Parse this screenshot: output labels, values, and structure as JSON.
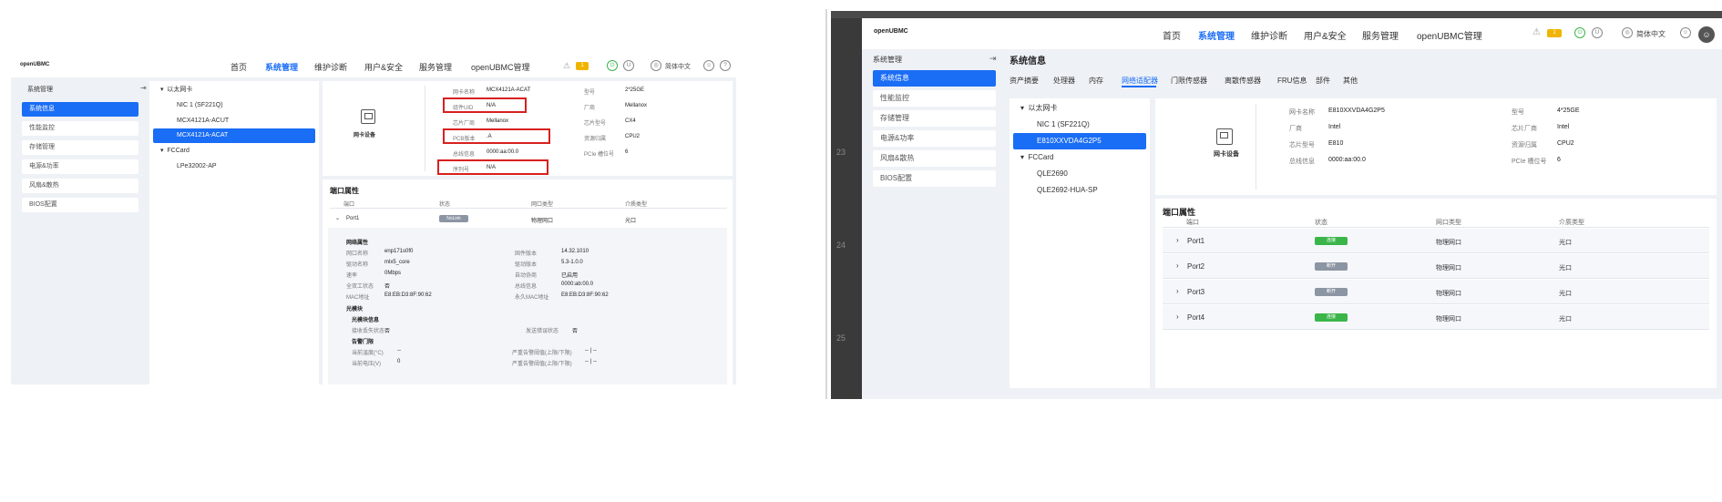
{
  "brand": "openUBMC",
  "left": {
    "nav": [
      "首页",
      "系统管理",
      "维护诊断",
      "用户&安全",
      "服务管理",
      "openUBMC管理"
    ],
    "nav_active": 1,
    "badge_count": "1",
    "lang": "简体中文",
    "sidebar_title": "系统管理",
    "sidebar_items": [
      "系统信息",
      "性能监控",
      "存储管理",
      "电源&功率",
      "风扇&散热",
      "BIOS配置"
    ],
    "tree": {
      "group1": "以太网卡",
      "nics": [
        "NIC 1 (SF221Q)",
        "MCX4121A-ACUT",
        "MCX4121A-ACAT"
      ],
      "group2": "FCCard",
      "fc": [
        "LPe32002-AP"
      ]
    },
    "card_label": "网卡设备",
    "card_info": [
      {
        "label": "网卡名称",
        "value": "MCX4121A-ACAT"
      },
      {
        "label": "组件UID",
        "value": "N/A"
      },
      {
        "label": "芯片厂商",
        "value": "Mellanox"
      },
      {
        "label": "PCB版本",
        "value": ".A"
      },
      {
        "label": "总线信息",
        "value": "0000:aa:00.0"
      },
      {
        "label": "序列号",
        "value": "N/A"
      }
    ],
    "card_info_right": [
      {
        "label": "型号",
        "value": "2*25GE"
      },
      {
        "label": "厂商",
        "value": "Mellanox"
      },
      {
        "label": "芯片型号",
        "value": "CX4"
      },
      {
        "label": "资源归属",
        "value": "CPU2"
      },
      {
        "label": "PCIe 槽位号",
        "value": "6"
      }
    ],
    "port_section_title": "端口属性",
    "port_headers": [
      "端口",
      "状态",
      "网口类型",
      "介质类型"
    ],
    "port1": {
      "name": "Port1",
      "status": "NoLink",
      "type": "物理网口",
      "media": "光口"
    },
    "net_props_title": "网络属性",
    "net_props": [
      {
        "label": "网口名称",
        "value": "enp171s0f0",
        "label2": "固件版本",
        "value2": "14.32.1010"
      },
      {
        "label": "驱动名称",
        "value": "mlx5_core",
        "label2": "驱动版本",
        "value2": "5.3-1.0.0"
      },
      {
        "label": "速率",
        "value": "0Mbps",
        "label2": "自动协商",
        "value2": "已启用"
      },
      {
        "label": "全双工状态",
        "value": "否",
        "label2": "总线信息",
        "value2": "0000:ab:00.0"
      },
      {
        "label": "MAC地址",
        "value": "E8:EB:D3:8F:90:62",
        "label2": "永久MAC地址",
        "value2": "E8:EB:D3:8F:90:62"
      }
    ],
    "optical_title": "光模块",
    "optical_status_title": "光模块信息",
    "optical_rows": [
      {
        "label": "接收丢失状态",
        "value": "否",
        "label2": "发送错误状态",
        "value2": "否"
      }
    ],
    "threshold_title": "告警门限",
    "threshold_rows": [
      {
        "label": "当前温度(°C)",
        "value": "--",
        "label2": "严重告警阈值(上限/下限)",
        "value2": "-- | --"
      },
      {
        "label": "当前电压(V)",
        "value": "0",
        "label2": "严重告警阈值(上限/下限)",
        "value2": "-- | --"
      }
    ]
  },
  "right": {
    "nav": [
      "首页",
      "系统管理",
      "维护诊断",
      "用户&安全",
      "服务管理",
      "openUBMC管理"
    ],
    "nav_active": 1,
    "badge_count": "1",
    "lang": "简体中文",
    "gutter": [
      "23",
      "24",
      "25"
    ],
    "sidebar_title": "系统管理",
    "sidebar_items": [
      "系统信息",
      "性能监控",
      "存储管理",
      "电源&功率",
      "风扇&散热",
      "BIOS配置"
    ],
    "page_title": "系统信息",
    "tabs": [
      "资产摘要",
      "处理器",
      "内存",
      "网络适配器",
      "门限传感器",
      "离散传感器",
      "FRU信息",
      "部件",
      "其他"
    ],
    "tab_active": 3,
    "tree": {
      "group1": "以太网卡",
      "nics": [
        "NIC 1 (SF221Q)",
        "E810XXVDA4G2P5"
      ],
      "group2": "FCCard",
      "fc": [
        "QLE2690",
        "QLE2692-HUA-SP"
      ]
    },
    "card_label": "网卡设备",
    "card_info": [
      {
        "label": "网卡名称",
        "value": "E810XXVDA4G2P5"
      },
      {
        "label": "厂商",
        "value": "Intel"
      },
      {
        "label": "芯片型号",
        "value": "E810"
      },
      {
        "label": "总线信息",
        "value": "0000:aa:00.0"
      }
    ],
    "card_info_right": [
      {
        "label": "型号",
        "value": "4*25GE"
      },
      {
        "label": "芯片厂商",
        "value": "Intel"
      },
      {
        "label": "资源归属",
        "value": "CPU2"
      },
      {
        "label": "PCIe 槽位号",
        "value": "6"
      }
    ],
    "port_section_title": "端口属性",
    "port_headers": [
      "端口",
      "状态",
      "网口类型",
      "介质类型"
    ],
    "ports": [
      {
        "name": "Port1",
        "status": "连接",
        "type": "物理网口",
        "media": "光口"
      },
      {
        "name": "Port2",
        "status": "断开",
        "type": "物理网口",
        "media": "光口"
      },
      {
        "name": "Port3",
        "status": "断开",
        "type": "物理网口",
        "media": "光口"
      },
      {
        "name": "Port4",
        "status": "连接",
        "type": "物理网口",
        "media": "光口"
      }
    ],
    "colors": {
      "connected": "#3bb54a",
      "disconnected": "#8c95a3"
    }
  },
  "colors": {
    "accent": "#1a6df5",
    "highlight_box": "#d82020",
    "nolink": "#8c95a3"
  }
}
